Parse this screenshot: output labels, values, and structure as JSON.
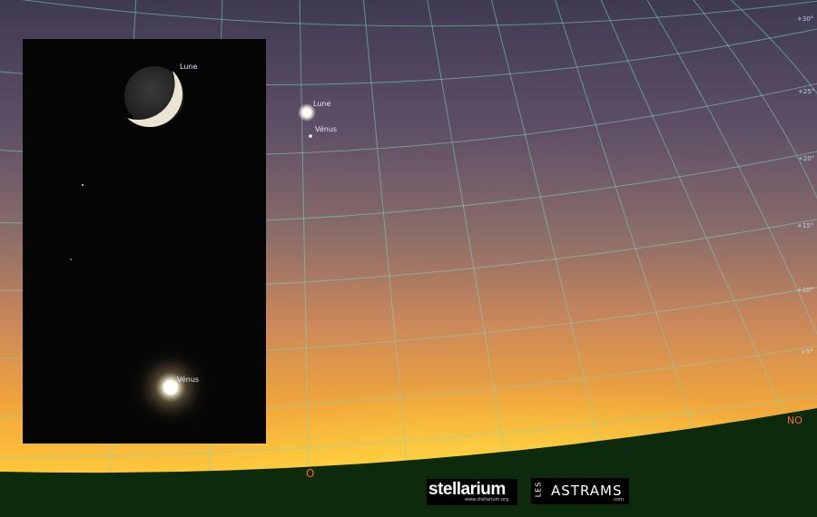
{
  "sky_labels": {
    "moon": "Lune",
    "venus": "Vénus"
  },
  "inset_labels": {
    "moon": "Lune",
    "venus": "Vénus"
  },
  "cardinal": {
    "west": "O",
    "northwest": "NO"
  },
  "altitude_labels": [
    "+30°",
    "+25°",
    "+20°",
    "+15°",
    "+10°",
    "+5°"
  ],
  "logos": {
    "stellarium": "stellarium",
    "stellarium_url": "www.stellarium.org",
    "astrams_les": "LES",
    "astrams": "ASTRAMS",
    "astrams_com": ".com"
  },
  "colors": {
    "grid": "#7fd6c0",
    "cardinal": "#ff6a2a",
    "ground": "#0c2a0c"
  }
}
